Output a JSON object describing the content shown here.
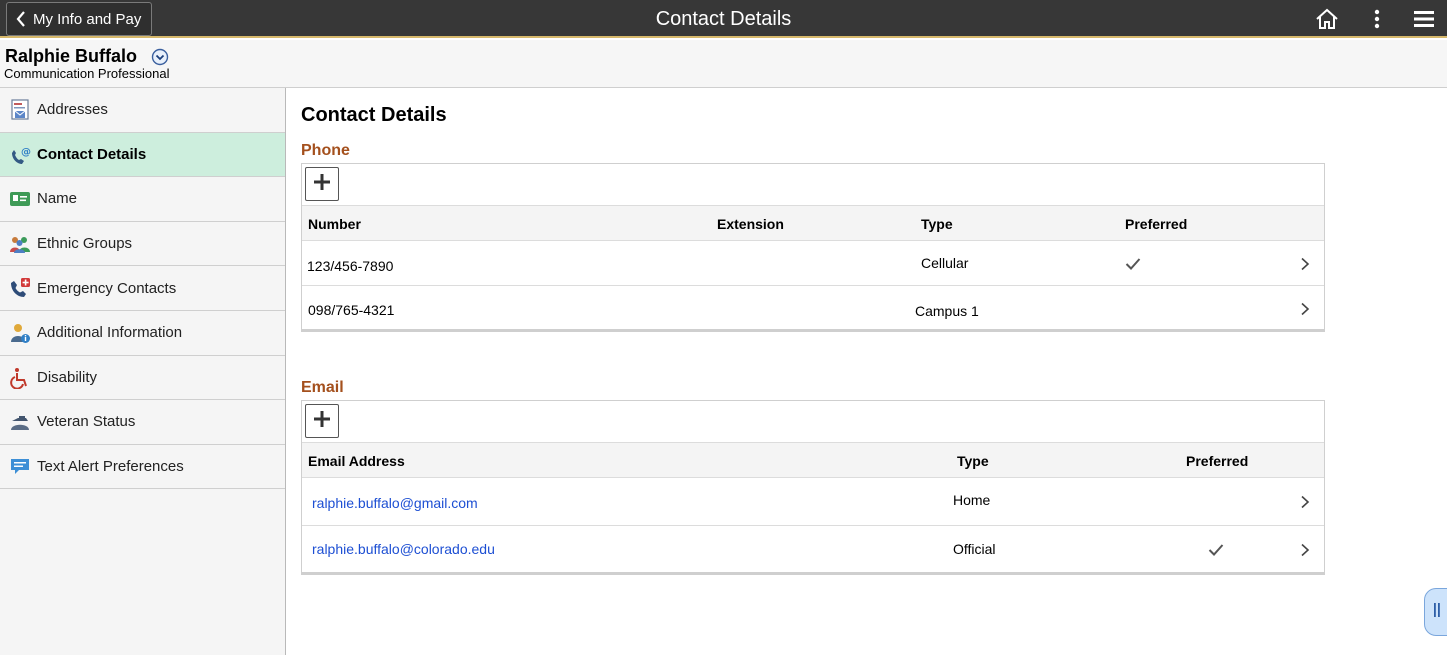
{
  "banner": {
    "back_label": "My Info and Pay",
    "title": "Contact Details",
    "icons": [
      "home-icon",
      "more-actions-icon",
      "menu-icon"
    ]
  },
  "employee": {
    "name": "Ralphie Buffalo",
    "job_title": "Communication Professional"
  },
  "sidebar": {
    "items": [
      {
        "label": "Addresses",
        "icon": "address-card-icon"
      },
      {
        "label": "Contact Details",
        "icon": "phone-email-icon",
        "selected": true
      },
      {
        "label": "Name",
        "icon": "name-card-icon"
      },
      {
        "label": "Ethnic Groups",
        "icon": "people-group-icon"
      },
      {
        "label": "Emergency Contacts",
        "icon": "emergency-phone-icon"
      },
      {
        "label": "Additional Information",
        "icon": "person-info-icon"
      },
      {
        "label": "Disability",
        "icon": "wheelchair-icon"
      },
      {
        "label": "Veteran Status",
        "icon": "veteran-icon"
      },
      {
        "label": "Text Alert Preferences",
        "icon": "chat-bubble-icon"
      }
    ]
  },
  "main": {
    "title": "Contact Details",
    "phone": {
      "section_label": "Phone",
      "columns": {
        "number": "Number",
        "extension": "Extension",
        "type": "Type",
        "preferred": "Preferred"
      },
      "rows": [
        {
          "number": "123/456-7890",
          "extension": "",
          "type": "Cellular",
          "preferred": true
        },
        {
          "number": "098/765-4321",
          "extension": "",
          "type": "Campus 1",
          "preferred": false
        }
      ]
    },
    "email": {
      "section_label": "Email",
      "columns": {
        "address": "Email Address",
        "type": "Type",
        "preferred": "Preferred"
      },
      "rows": [
        {
          "address": "ralphie.buffalo@gmail.com",
          "type": "Home",
          "preferred": false
        },
        {
          "address": "ralphie.buffalo@colorado.edu",
          "type": "Official",
          "preferred": true
        }
      ]
    }
  },
  "colors": {
    "banner_bg": "#373737",
    "banner_accent": "#d6b86b",
    "section_label": "#a4501d",
    "selected_nav": "#cdeedd",
    "link": "#1d4fd3"
  }
}
